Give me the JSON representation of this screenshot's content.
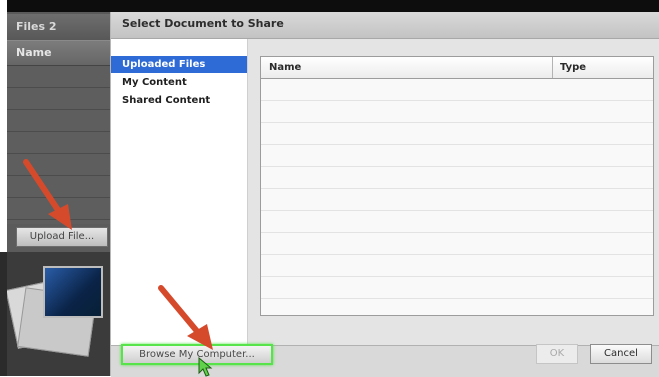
{
  "background_panel": {
    "title": "Files 2",
    "column_header": "Name",
    "upload_button_label": "Upload File..."
  },
  "dialog": {
    "title": "Select Document to Share",
    "nav_items": [
      {
        "label": "Uploaded Files",
        "selected": true
      },
      {
        "label": "My Content",
        "selected": false
      },
      {
        "label": "Shared Content",
        "selected": false
      }
    ],
    "table": {
      "columns": [
        "Name",
        "Type"
      ],
      "rows": []
    },
    "footer": {
      "browse_label": "Browse My Computer...",
      "ok_label": "OK",
      "cancel_label": "Cancel"
    }
  },
  "annotations": {
    "arrow_color": "#d64a2c",
    "highlight_color": "#57e34a",
    "icons": [
      "red-arrow-icon",
      "red-arrow-icon",
      "mouse-cursor-icon"
    ]
  }
}
